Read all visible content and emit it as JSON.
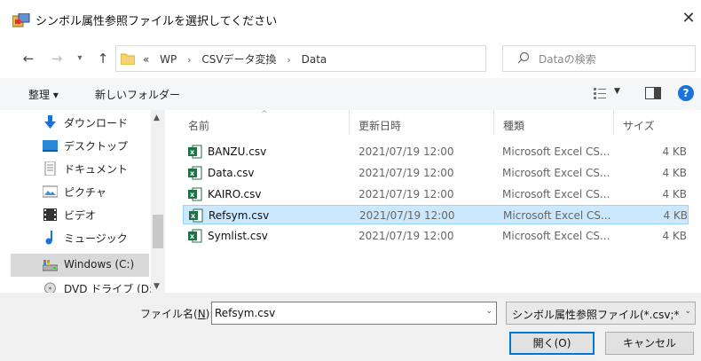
{
  "window": {
    "title": "シンボル属性参照ファイルを選択してください",
    "close_label": "✕"
  },
  "address": {
    "overflow": "«",
    "crumbs": [
      "WP",
      "CSVデータ変換",
      "Data"
    ],
    "search_placeholder": "Dataの検索"
  },
  "toolbar": {
    "organize_label": "整理 ▾",
    "new_folder_label": "新しいフォルダー",
    "help_label": "?"
  },
  "nav": {
    "items": [
      {
        "label": "ダウンロード",
        "icon": "download-arrow-icon"
      },
      {
        "label": "デスクトップ",
        "icon": "desktop-icon"
      },
      {
        "label": "ドキュメント",
        "icon": "documents-icon"
      },
      {
        "label": "ピクチャ",
        "icon": "pictures-icon"
      },
      {
        "label": "ビデオ",
        "icon": "video-icon"
      },
      {
        "label": "ミュージック",
        "icon": "music-note-icon"
      },
      {
        "label": "Windows (C:)",
        "icon": "drive-icon",
        "selected": true
      },
      {
        "label": "DVD ドライブ (D:)",
        "icon": "dvd-drive-icon"
      }
    ]
  },
  "columns": {
    "name": "名前",
    "date": "更新日時",
    "type": "種類",
    "size": "サイズ"
  },
  "files": [
    {
      "name": "BANZU.csv",
      "date": "2021/07/19 12:00",
      "type": "Microsoft Excel CS...",
      "size": "4 KB"
    },
    {
      "name": "Data.csv",
      "date": "2021/07/19 12:00",
      "type": "Microsoft Excel CS...",
      "size": "4 KB"
    },
    {
      "name": "KAIRO.csv",
      "date": "2021/07/19 12:00",
      "type": "Microsoft Excel CS...",
      "size": "4 KB"
    },
    {
      "name": "Refsym.csv",
      "date": "2021/07/19 12:00",
      "type": "Microsoft Excel CS...",
      "size": "4 KB",
      "selected": true
    },
    {
      "name": "Symlist.csv",
      "date": "2021/07/19 12:00",
      "type": "Microsoft Excel CS...",
      "size": "4 KB"
    }
  ],
  "bottom": {
    "filename_label_prefix": "ファイル名(",
    "filename_label_key": "N",
    "filename_label_suffix": "):",
    "filename_value": "Refsym.csv",
    "filetype_value": "シンボル属性参照ファイル(*.csv;*.t",
    "open_label": "開く(O)",
    "cancel_label": "キャンセル"
  },
  "colors": {
    "selection_bg": "#cce8ff",
    "selection_border": "#99d1ff",
    "primary_border": "#0078d7",
    "excel_green": "#1e7145",
    "help_blue": "#1a73d9"
  }
}
